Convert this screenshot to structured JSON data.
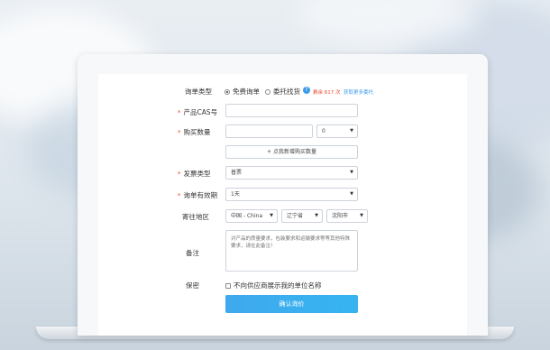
{
  "form": {
    "inquiry_type": {
      "label": "询单类型",
      "option_free": "免费询单",
      "option_entrust": "委托找货",
      "remaining": "剩余 617 次",
      "get_more": "获取更多委托"
    },
    "cas": {
      "label": "产品CAS号",
      "value": ""
    },
    "quantity": {
      "label": "购买数量",
      "value": "",
      "unit": "0"
    },
    "add_quantity_button": "+ 点我新增购买数量",
    "invoice": {
      "label": "发票类型",
      "value": "普票"
    },
    "validity": {
      "label": "询单有效期",
      "value": "1天"
    },
    "region": {
      "label": "寄往地区",
      "country": "中国 - China",
      "province": "辽宁省",
      "city": "沈阳市"
    },
    "remark": {
      "label": "备注",
      "placeholder": "对产品的质量要求，包装要求和运输要求等等其他特殊要求，请在此备注！"
    },
    "confidential": {
      "label": "保密",
      "option": "不向供应商展示我的单位名称"
    },
    "submit_button": "确认询价"
  },
  "colors": {
    "accent": "#3fa9ee",
    "required": "#e8472f",
    "remaining": "#e8472f"
  }
}
